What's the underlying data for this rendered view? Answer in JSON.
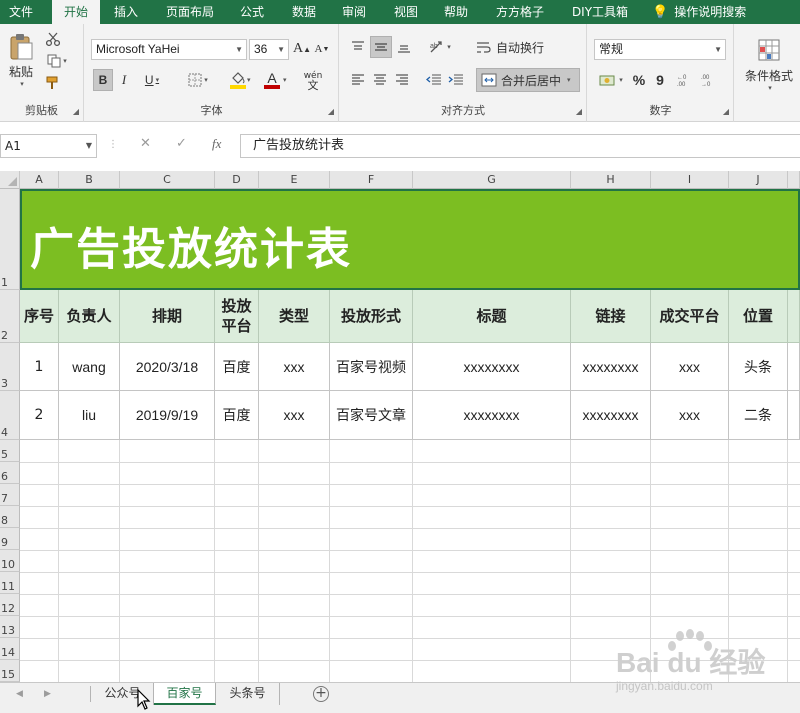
{
  "menu": {
    "tabs": [
      "文件",
      "开始",
      "插入",
      "页面布局",
      "公式",
      "数据",
      "审阅",
      "视图",
      "帮助",
      "方方格子",
      "DIY工具箱",
      "操作说明搜索"
    ],
    "active": "开始"
  },
  "ribbon": {
    "clipboard": {
      "paste": "粘贴",
      "label": "剪贴板"
    },
    "font": {
      "name": "Microsoft YaHei",
      "size": "36",
      "bold": "B",
      "italic": "I",
      "underline": "U",
      "grow": "A",
      "shrink": "A",
      "fill_color": "#ffd800",
      "font_color": "#c00000",
      "wen": "wén",
      "wen_char": "文",
      "label": "字体"
    },
    "alignment": {
      "wrap": "自动换行",
      "merge": "合并后居中",
      "label": "对齐方式"
    },
    "number": {
      "format": "常规",
      "percent": "%",
      "comma": "9",
      "label": "数字"
    },
    "styles": {
      "conditional": "条件格式"
    }
  },
  "formula_bar": {
    "name_box": "A1",
    "cancel": "✕",
    "enter": "✓",
    "fx": "fx",
    "content": "广告投放统计表"
  },
  "columns": [
    "A",
    "B",
    "C",
    "D",
    "E",
    "F",
    "G",
    "H",
    "I",
    "J"
  ],
  "rows": [
    "1",
    "2",
    "3",
    "4",
    "5",
    "6",
    "7",
    "8",
    "9",
    "10",
    "11",
    "12",
    "13",
    "14",
    "15"
  ],
  "sheet": {
    "title": "广告投放统计表",
    "title_bg": "#7cbe22",
    "headers": [
      "序号",
      "负责人",
      "排期",
      "投放平台",
      "类型",
      "投放形式",
      "标题",
      "链接",
      "成交平台",
      "位置"
    ],
    "data": [
      [
        "1",
        "wang",
        "2020/3/18",
        "百度",
        "xxx",
        "百家号视频",
        "xxxxxxxx",
        "xxxxxxxx",
        "xxx",
        "头条"
      ],
      [
        "2",
        "liu",
        "2019/9/19",
        "百度",
        "xxx",
        "百家号文章",
        "xxxxxxxx",
        "xxxxxxxx",
        "xxx",
        "二条"
      ]
    ]
  },
  "sheet_tabs": [
    "公众号",
    "百家号",
    "头条号"
  ],
  "active_sheet": "百家号",
  "add_sheet": "+",
  "watermark": {
    "logo": "Bai du 经验",
    "url": "jingyan.baidu.com"
  }
}
